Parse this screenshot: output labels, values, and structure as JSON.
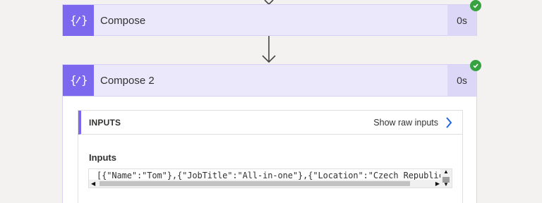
{
  "flow": {
    "actions": [
      {
        "title": "Compose",
        "duration": "0s",
        "icon": "braces-pen-icon",
        "status": "succeeded"
      },
      {
        "title": "Compose 2",
        "duration": "0s",
        "icon": "braces-pen-icon",
        "status": "succeeded",
        "inputs": {
          "panel_label": "INPUTS",
          "raw_link": "Show raw inputs",
          "section_label": "Inputs",
          "value": "[{\"Name\":\"Tom\"},{\"JobTitle\":\"All-in-one\"},{\"Location\":\"Czech Republic\"}"
        }
      }
    ]
  },
  "icon_glyph": "{⁄}",
  "colors": {
    "accent": "#7b68ee",
    "card_bg": "#ebe8fb",
    "duration_bg": "#dcd6f7",
    "success": "#36a340",
    "link_chevron": "#2266e3"
  }
}
